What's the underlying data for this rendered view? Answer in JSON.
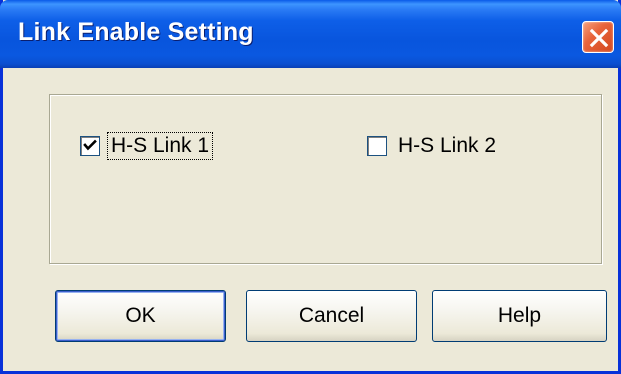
{
  "window": {
    "title": "Link Enable Setting"
  },
  "checkboxes": [
    {
      "label": "H-S Link 1",
      "checked": true,
      "focused": true
    },
    {
      "label": "H-S Link 2",
      "checked": false,
      "focused": false
    }
  ],
  "buttons": {
    "ok_label": "OK",
    "cancel_label": "Cancel",
    "help_label": "Help"
  },
  "colors": {
    "titlebar": "#0855dd",
    "dialog_background": "#ece9d8",
    "close_button": "#e8643b",
    "button_border": "#003c74"
  },
  "icons": {
    "close": "close-icon",
    "check": "checkmark-icon"
  }
}
